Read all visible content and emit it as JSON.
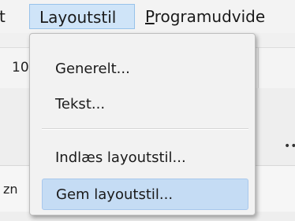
{
  "menubar": {
    "partial_item": "t",
    "active_item": "Layoutstil",
    "program_item_first": "P",
    "program_item_rest": "rogramudvide"
  },
  "background": {
    "toolbar_text": "10",
    "sidebar_text": "zn",
    "marker": "••"
  },
  "dropdown": {
    "items": [
      {
        "label": "Generelt..."
      },
      {
        "label": "Tekst..."
      },
      {
        "label": "Indlæs layoutstil..."
      },
      {
        "label": "Gem layoutstil..."
      }
    ],
    "highlighted_index": 3,
    "highlight_color": "#c5dcf4"
  }
}
